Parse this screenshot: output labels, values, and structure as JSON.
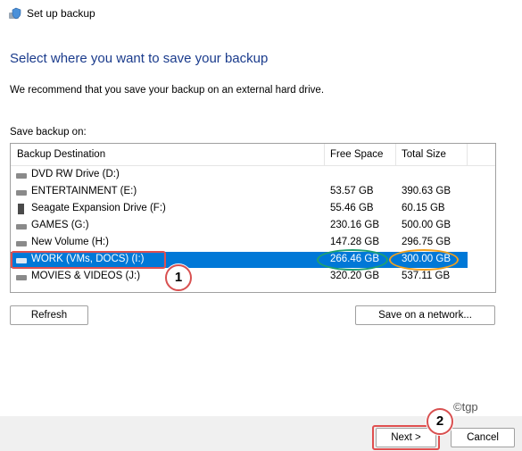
{
  "window": {
    "title": "Set up backup",
    "title_icon": "backup-shield-icon"
  },
  "heading": "Select where you want to save your backup",
  "intro": "We recommend that you save your backup on an external hard drive.",
  "save_on_label": "Save backup on:",
  "table": {
    "columns": [
      "Backup Destination",
      "Free Space",
      "Total Size"
    ],
    "rows": [
      {
        "name": "DVD RW Drive (D:)",
        "free": "",
        "total": "",
        "icon": "dvd-drive-icon",
        "selected": false
      },
      {
        "name": "ENTERTAINMENT (E:)",
        "free": "53.57 GB",
        "total": "390.63 GB",
        "icon": "hard-drive-icon",
        "selected": false
      },
      {
        "name": "Seagate Expansion Drive (F:)",
        "free": "55.46 GB",
        "total": "60.15 GB",
        "icon": "external-drive-icon",
        "selected": false
      },
      {
        "name": "GAMES (G:)",
        "free": "230.16 GB",
        "total": "500.00 GB",
        "icon": "hard-drive-icon",
        "selected": false
      },
      {
        "name": "New Volume (H:)",
        "free": "147.28 GB",
        "total": "296.75 GB",
        "icon": "hard-drive-icon",
        "selected": false
      },
      {
        "name": "WORK (VMs, DOCS) (I:)",
        "free": "266.46 GB",
        "total": "300.00 GB",
        "icon": "hard-drive-icon",
        "selected": true
      },
      {
        "name": "MOVIES & VIDEOS (J:)",
        "free": "320.20 GB",
        "total": "537.11 GB",
        "icon": "hard-drive-icon",
        "selected": false
      }
    ]
  },
  "buttons": {
    "refresh": "Refresh",
    "network": "Save on a network...",
    "next": "Next >",
    "cancel": "Cancel"
  },
  "annotations": {
    "badge1": "1",
    "badge2": "2",
    "watermark": "©tgp"
  },
  "colors": {
    "selection": "#0078d7",
    "heading": "#1a3b8c",
    "callout_red": "#e05050",
    "oval_green": "#20a070",
    "oval_orange": "#f0a020"
  }
}
